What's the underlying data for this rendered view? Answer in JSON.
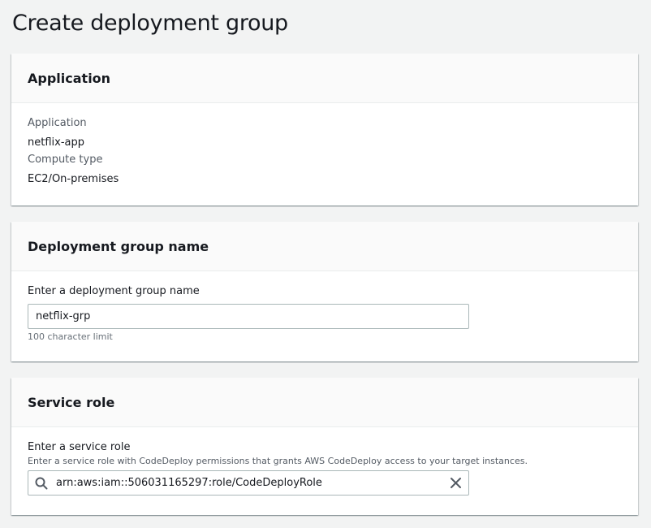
{
  "page": {
    "title": "Create deployment group"
  },
  "application_panel": {
    "heading": "Application",
    "application_label": "Application",
    "application_value": "netflix-app",
    "compute_type_label": "Compute type",
    "compute_type_value": "EC2/On-premises"
  },
  "group_name_panel": {
    "heading": "Deployment group name",
    "field_label": "Enter a deployment group name",
    "field_value": "netflix-grp",
    "constraint": "100 character limit"
  },
  "service_role_panel": {
    "heading": "Service role",
    "field_label": "Enter a service role",
    "field_description": "Enter a service role with CodeDeploy permissions that grants AWS CodeDeploy access to your target instances.",
    "field_value": "arn:aws:iam::506031165297:role/CodeDeployRole",
    "search_icon": "search-icon",
    "clear_icon": "close-icon"
  }
}
